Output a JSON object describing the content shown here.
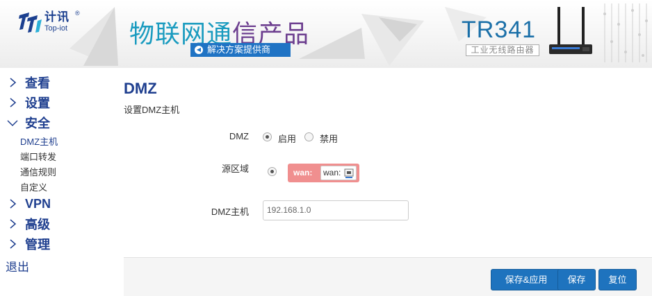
{
  "banner": {
    "logo_cn": "计讯",
    "logo_en": "Top-iot",
    "logo_reg": "®",
    "slogan_part1": "物联网通",
    "slogan_part2": "信产品",
    "slogan_sub": "解决方案提供商",
    "model": "TR341",
    "model_sub": "工业无线路由器"
  },
  "sidebar": {
    "items": [
      {
        "label": "查看"
      },
      {
        "label": "设置"
      },
      {
        "label": "安全"
      },
      {
        "label": "VPN"
      },
      {
        "label": "高级"
      },
      {
        "label": "管理"
      }
    ],
    "security_sub": [
      "DMZ主机",
      "端口转发",
      "通信规则",
      "自定义"
    ],
    "exit": "退出"
  },
  "main": {
    "title": "DMZ",
    "description": "设置DMZ主机",
    "dmz_label": "DMZ",
    "enable_label": "启用",
    "disable_label": "禁用",
    "dmz_state": "启用",
    "source_zone_label": "源区域",
    "zone_name": "wan:",
    "zone_iface": "wan:",
    "host_label": "DMZ主机",
    "host_value": "192.168.1.0"
  },
  "actions": {
    "save_apply": "保存&应用",
    "save": "保存",
    "reset": "复位"
  },
  "colors": {
    "brand": "#1f3f8f",
    "button": "#1e73be",
    "zone": "#f08f8f"
  }
}
